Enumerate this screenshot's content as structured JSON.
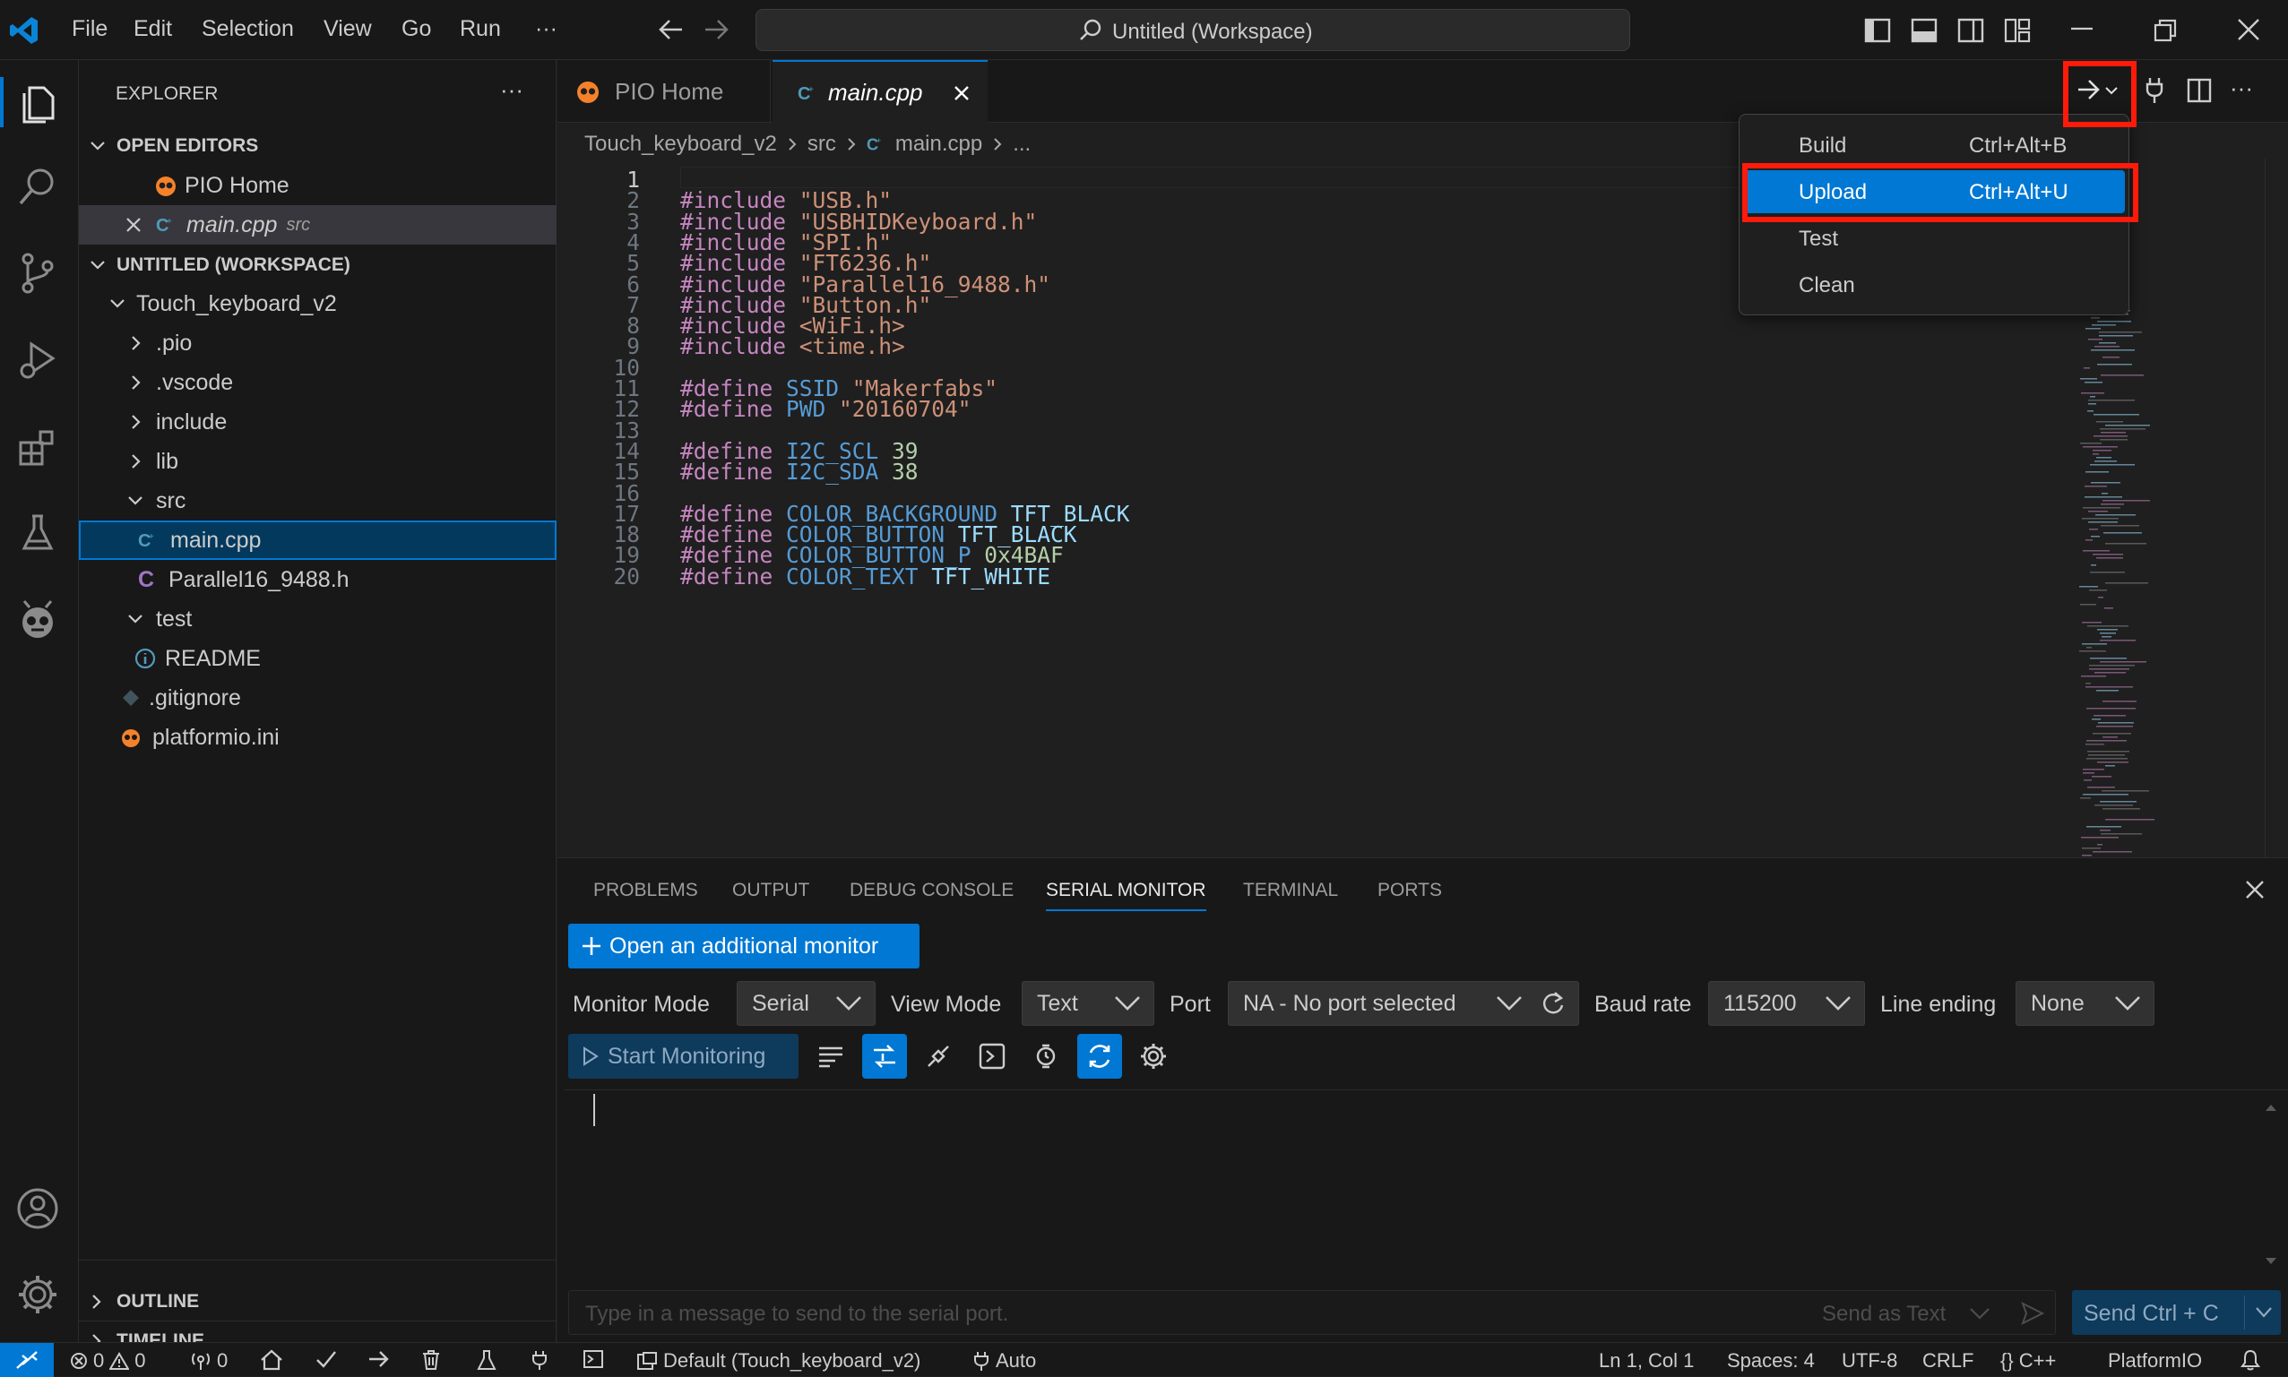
{
  "titlebar": {
    "menus": [
      "File",
      "Edit",
      "Selection",
      "View",
      "Go",
      "Run",
      "···"
    ],
    "command_center": "Untitled (Workspace)"
  },
  "sidebar": {
    "title": "EXPLORER",
    "open_editors_header": "OPEN EDITORS",
    "open_editors": [
      {
        "name": "PIO Home",
        "detail": ""
      },
      {
        "name": "main.cpp",
        "detail": "src"
      }
    ],
    "workspace_header": "UNTITLED (WORKSPACE)",
    "tree": [
      "Touch_keyboard_v2",
      ".pio",
      ".vscode",
      "include",
      "lib",
      "src",
      "main.cpp",
      "Parallel16_9488.h",
      "test",
      "README",
      ".gitignore",
      "platformio.ini"
    ],
    "outline": "OUTLINE",
    "timeline": "TIMELINE"
  },
  "tabs": [
    {
      "label": "PIO Home"
    },
    {
      "label": "main.cpp"
    }
  ],
  "breadcrumb": [
    "Touch_keyboard_v2",
    "src",
    "main.cpp",
    "..."
  ],
  "code_lines": [
    {
      "n": "1",
      "parts": []
    },
    {
      "n": "2",
      "parts": [
        [
          "kw",
          "#include "
        ],
        [
          "st",
          "\"USB.h\""
        ]
      ]
    },
    {
      "n": "3",
      "parts": [
        [
          "kw",
          "#include "
        ],
        [
          "st",
          "\"USBHIDKeyboard.h\""
        ]
      ]
    },
    {
      "n": "4",
      "parts": [
        [
          "kw",
          "#include "
        ],
        [
          "st",
          "\"SPI.h\""
        ]
      ]
    },
    {
      "n": "5",
      "parts": [
        [
          "kw",
          "#include "
        ],
        [
          "st",
          "\"FT6236.h\""
        ]
      ]
    },
    {
      "n": "6",
      "parts": [
        [
          "kw",
          "#include "
        ],
        [
          "st",
          "\"Parallel16_9488.h\""
        ]
      ]
    },
    {
      "n": "7",
      "parts": [
        [
          "kw",
          "#include "
        ],
        [
          "st",
          "\"Button.h\""
        ]
      ]
    },
    {
      "n": "8",
      "parts": [
        [
          "kw",
          "#include "
        ],
        [
          "st",
          "<WiFi.h>"
        ]
      ]
    },
    {
      "n": "9",
      "parts": [
        [
          "kw",
          "#include "
        ],
        [
          "st",
          "<time.h>"
        ]
      ]
    },
    {
      "n": "10",
      "parts": []
    },
    {
      "n": "11",
      "parts": [
        [
          "kw",
          "#define "
        ],
        [
          "mc",
          "SSID "
        ],
        [
          "st",
          "\"Makerfabs\""
        ]
      ]
    },
    {
      "n": "12",
      "parts": [
        [
          "kw",
          "#define "
        ],
        [
          "mc",
          "PWD "
        ],
        [
          "st",
          "\"20160704\""
        ]
      ]
    },
    {
      "n": "13",
      "parts": []
    },
    {
      "n": "14",
      "parts": [
        [
          "kw",
          "#define "
        ],
        [
          "mc",
          "I2C_SCL "
        ],
        [
          "nm",
          "39"
        ]
      ]
    },
    {
      "n": "15",
      "parts": [
        [
          "kw",
          "#define "
        ],
        [
          "mc",
          "I2C_SDA "
        ],
        [
          "nm",
          "38"
        ]
      ]
    },
    {
      "n": "16",
      "parts": []
    },
    {
      "n": "17",
      "parts": [
        [
          "kw",
          "#define "
        ],
        [
          "mc",
          "COLOR_BACKGROUND "
        ],
        [
          "id",
          "TFT_BLACK"
        ]
      ]
    },
    {
      "n": "18",
      "parts": [
        [
          "kw",
          "#define "
        ],
        [
          "mc",
          "COLOR_BUTTON "
        ],
        [
          "id",
          "TFT_BLACK"
        ]
      ]
    },
    {
      "n": "19",
      "parts": [
        [
          "kw",
          "#define "
        ],
        [
          "mc",
          "COLOR_BUTTON_P "
        ],
        [
          "nm",
          "0x4BAF"
        ]
      ]
    },
    {
      "n": "20",
      "parts": [
        [
          "kw",
          "#define "
        ],
        [
          "mc",
          "COLOR_TEXT "
        ],
        [
          "id",
          "TFT_WHITE"
        ]
      ]
    }
  ],
  "run_menu": [
    {
      "label": "Build",
      "shortcut": "Ctrl+Alt+B"
    },
    {
      "label": "Upload",
      "shortcut": "Ctrl+Alt+U"
    },
    {
      "label": "Test",
      "shortcut": ""
    },
    {
      "label": "Clean",
      "shortcut": ""
    }
  ],
  "panel": {
    "tabs": [
      "PROBLEMS",
      "OUTPUT",
      "DEBUG CONSOLE",
      "SERIAL MONITOR",
      "TERMINAL",
      "PORTS"
    ],
    "active_tab": "SERIAL MONITOR",
    "open_monitor_button": "Open an additional monitor",
    "monitor_mode_label": "Monitor Mode",
    "monitor_mode_value": "Serial",
    "view_mode_label": "View Mode",
    "view_mode_value": "Text",
    "port_label": "Port",
    "port_value": "NA - No port selected",
    "baud_label": "Baud rate",
    "baud_value": "115200",
    "line_ending_label": "Line ending",
    "line_ending_value": "None",
    "start_button": "Start Monitoring",
    "message_placeholder": "Type in a message to send to the serial port.",
    "send_as": "Send as Text",
    "send_button": "Send Ctrl + C"
  },
  "statusbar": {
    "errors": "0",
    "warnings": "0",
    "ports": "0",
    "env": "Default (Touch_keyboard_v2)",
    "auto": "Auto",
    "position": "Ln 1, Col 1",
    "spaces": "Spaces: 4",
    "encoding": "UTF-8",
    "eol": "CRLF",
    "language": "C++",
    "platform": "PlatformIO"
  },
  "colors": {
    "accent": "#0078d4",
    "highlight": "#ff1a0a",
    "pio_orange": "#f5822a"
  }
}
